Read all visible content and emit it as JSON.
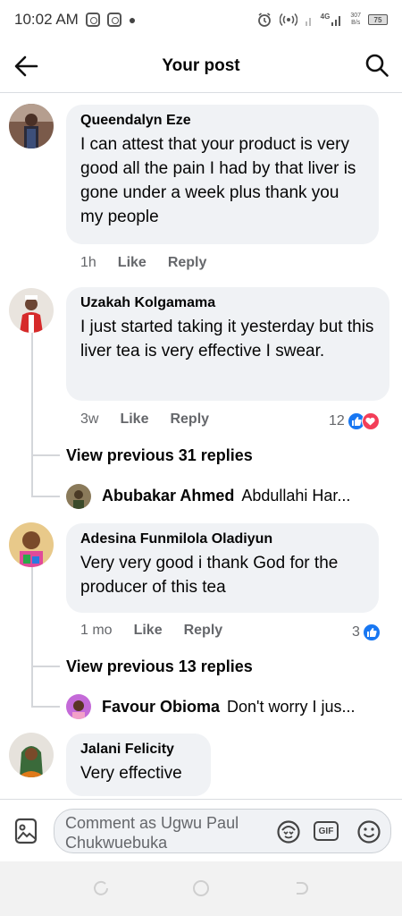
{
  "status_bar": {
    "time": "10:02 AM",
    "network": "4G",
    "speed_value": "307",
    "speed_unit": "B/s",
    "battery": "75"
  },
  "header": {
    "title": "Your post"
  },
  "comments": [
    {
      "author": "Queendalyn Eze",
      "text": "I can attest that your product is very good all the pain I had by that liver is gone under a week plus thank you my people",
      "time": "1h",
      "like_label": "Like",
      "reply_label": "Reply"
    },
    {
      "author": "Uzakah Kolgamama",
      "text": "I just started taking it yesterday but this liver tea is very effective I swear.",
      "time": "3w",
      "like_label": "Like",
      "reply_label": "Reply",
      "reaction_count": "12",
      "view_previous": "View previous 31 replies",
      "reply": {
        "author": "Abubakar Ahmed",
        "text": "Abdullahi Har..."
      }
    },
    {
      "author": "Adesina Funmilola Oladiyun",
      "text": "Very very good i thank God for the producer of this tea",
      "time": "1 mo",
      "like_label": "Like",
      "reply_label": "Reply",
      "reaction_count": "3",
      "view_previous": "View previous 13 replies",
      "reply": {
        "author": "Favour Obioma",
        "text": "Don't worry I jus..."
      }
    },
    {
      "author": "Jalani Felicity",
      "text": "Very effective"
    }
  ],
  "composer": {
    "placeholder": "Comment as Ugwu Paul Chukwuebuka",
    "gif_label": "GIF"
  },
  "colors": {
    "like_blue": "#1877f2",
    "love_red": "#f33e58",
    "bubble_bg": "#f0f2f5",
    "meta_gray": "#65676b"
  }
}
